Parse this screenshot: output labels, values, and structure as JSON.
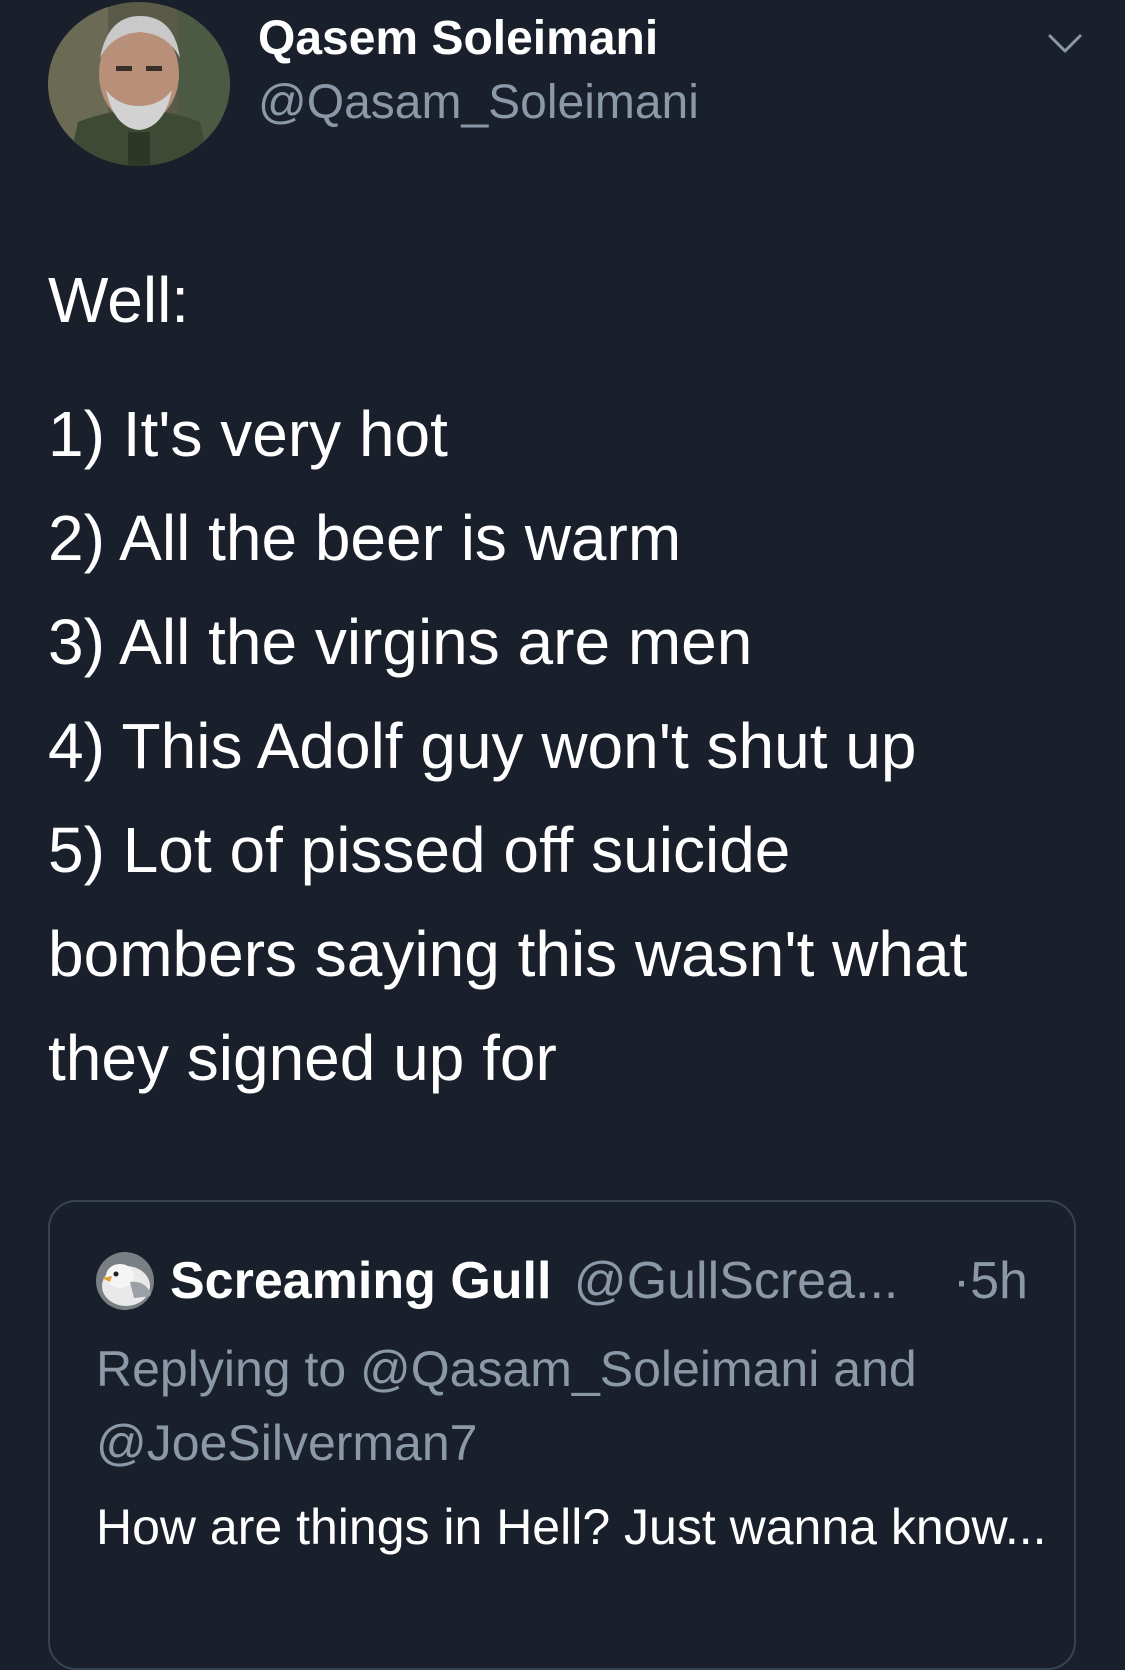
{
  "tweet": {
    "author": {
      "display_name": "Qasem Soleimani",
      "handle": "@Qasam_Soleimani",
      "avatar_icon": "profile-photo"
    },
    "menu_icon": "chevron-down-icon",
    "body": {
      "intro": "Well:",
      "lines": [
        "1) It's very hot",
        "2) All the beer is warm",
        "3) All the virgins are men",
        "4) This Adolf guy won't shut up",
        "5) Lot of pissed off suicide",
        "bombers saying this wasn't what",
        "they signed up for"
      ]
    }
  },
  "quoted_tweet": {
    "author": {
      "display_name": "Screaming Gull",
      "handle": "@GullScrea...",
      "avatar_icon": "seagull-avatar"
    },
    "time": "·5h",
    "replying_to": "Replying to @Qasam_Soleimani and @JoeSilverman7",
    "text": "How are things in Hell? Just wanna know..."
  },
  "colors": {
    "background": "#1a202b",
    "primary_text": "#ffffff",
    "secondary_text": "#8a98a8",
    "card_border": "#38444d"
  }
}
